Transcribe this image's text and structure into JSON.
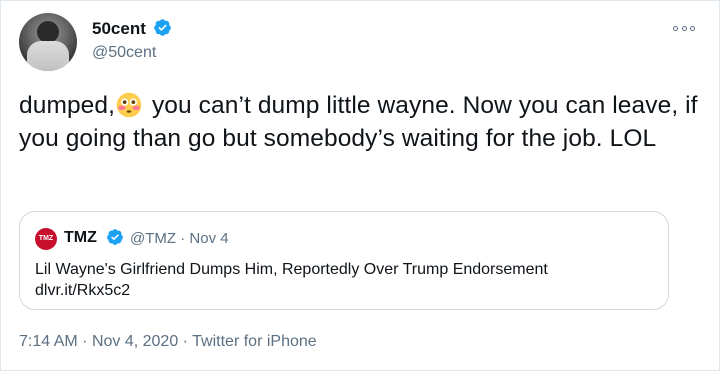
{
  "author": {
    "display_name": "50cent",
    "handle": "@50cent",
    "avatar_icon": "profile-photo",
    "verified": true
  },
  "menu": {
    "more_icon": "more-horizontal-icon"
  },
  "tweet": {
    "text_before_emoji": "dumped,",
    "emoji": "flushed-face-emoji",
    "text_after_emoji": " you can’t dump little wayne. Now you can leave, if you going than go but somebody’s waiting for the job. LOL"
  },
  "quoted_tweet": {
    "avatar_text": "TMZ",
    "display_name": "TMZ",
    "handle": "@TMZ",
    "date": "Nov 4",
    "separator": "·",
    "text_line1": "Lil Wayne's Girlfriend Dumps Him, Reportedly Over Trump Endorsement",
    "text_line2": "dlvr.it/Rkx5c2"
  },
  "footer": {
    "time": "7:14 AM",
    "date": "Nov 4, 2020",
    "source": "Twitter for iPhone",
    "separator": "·"
  },
  "colors": {
    "verified_blue": "#1da1f2",
    "secondary_text": "#5b7083",
    "tmz_red": "#c8102e"
  }
}
